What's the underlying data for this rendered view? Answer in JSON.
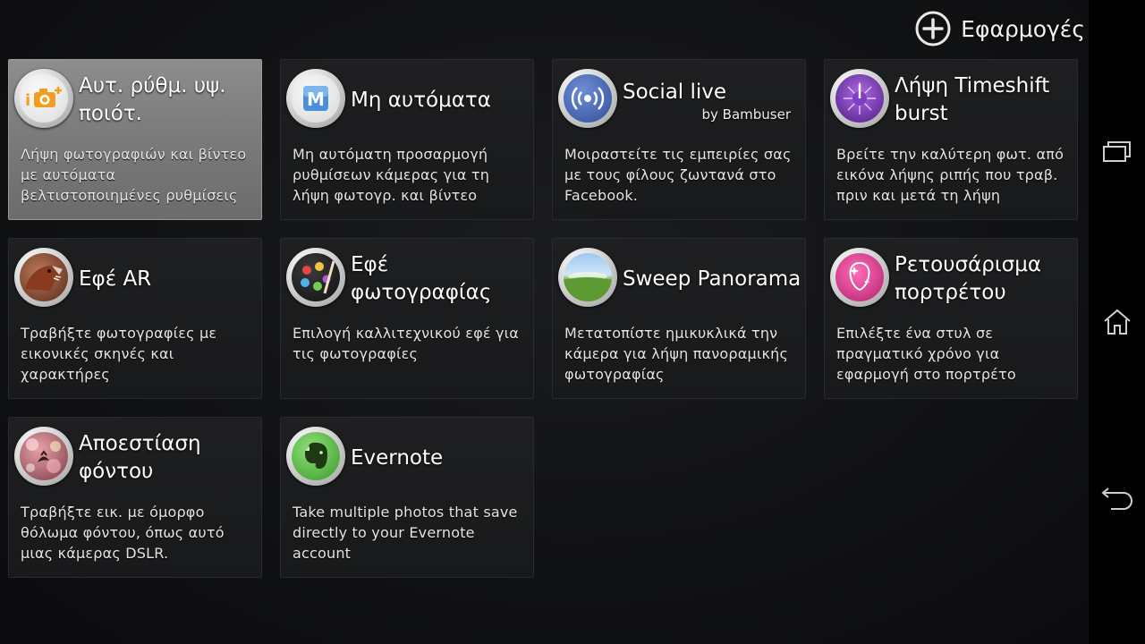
{
  "header": {
    "add_label": "Εφαρμογές"
  },
  "tiles": [
    {
      "title": "Αυτ. ρύθμ. υψ. ποιότ.",
      "subtitle": "",
      "description": "Λήψη φωτογραφιών και βίντεο με αυτόματα βελτιστοποιημένες ρυθμίσεις",
      "icon": "superior-auto-camera-icon",
      "selected": true
    },
    {
      "title": "Μη αυτόματα",
      "subtitle": "",
      "description": "Μη αυτόματη προσαρμογή ρυθμίσεων κάμερας για τη λήψη φωτογρ. και βίντεο",
      "icon": "manual-m-icon"
    },
    {
      "title": "Social live",
      "subtitle": "by Bambuser",
      "description": "Μοιραστείτε τις εμπειρίες σας με τους φίλους ζωντανά στο Facebook.",
      "icon": "broadcast-icon"
    },
    {
      "title": "Λήψη Timeshift burst",
      "subtitle": "",
      "description": "Βρείτε την καλύτερη φωτ. από εικόνα λήψης ριπής που τραβ. πριν και μετά τη λήψη",
      "icon": "timeshift-icon"
    },
    {
      "title": "Εφέ AR",
      "subtitle": "",
      "description": "Τραβήξτε φωτογραφίες με εικονικές σκηνές και χαρακτήρες",
      "icon": "dinosaur-icon"
    },
    {
      "title": "Εφέ φωτογραφίας",
      "subtitle": "",
      "description": "Επιλογή καλλιτεχνικού εφέ για τις φωτογραφίες",
      "icon": "palette-icon"
    },
    {
      "title": "Sweep Panorama",
      "subtitle": "",
      "description": "Μετατοπίστε ημικυκλικά την κάμερα για λήψη πανοραμικής φωτογραφίας",
      "icon": "panorama-icon"
    },
    {
      "title": "Ρετουσάρισμα πορτρέτου",
      "subtitle": "",
      "description": "Επιλέξτε ένα στυλ σε πραγματικό χρόνο για εφαρμογή στο πορτρέτο",
      "icon": "portrait-retouch-icon"
    },
    {
      "title": "Αποεστίαση φόντου",
      "subtitle": "",
      "description": "Τραβήξτε εικ. με όμορφο θόλωμα φόντου, όπως αυτό μιας κάμερας DSLR.",
      "icon": "bokeh-icon"
    },
    {
      "title": "Evernote",
      "subtitle": "",
      "description": "Take multiple photos that save directly to your Evernote account",
      "icon": "evernote-elephant-icon"
    }
  ],
  "navbar": {
    "buttons": [
      "recent-apps-icon",
      "home-icon",
      "back-icon"
    ]
  }
}
